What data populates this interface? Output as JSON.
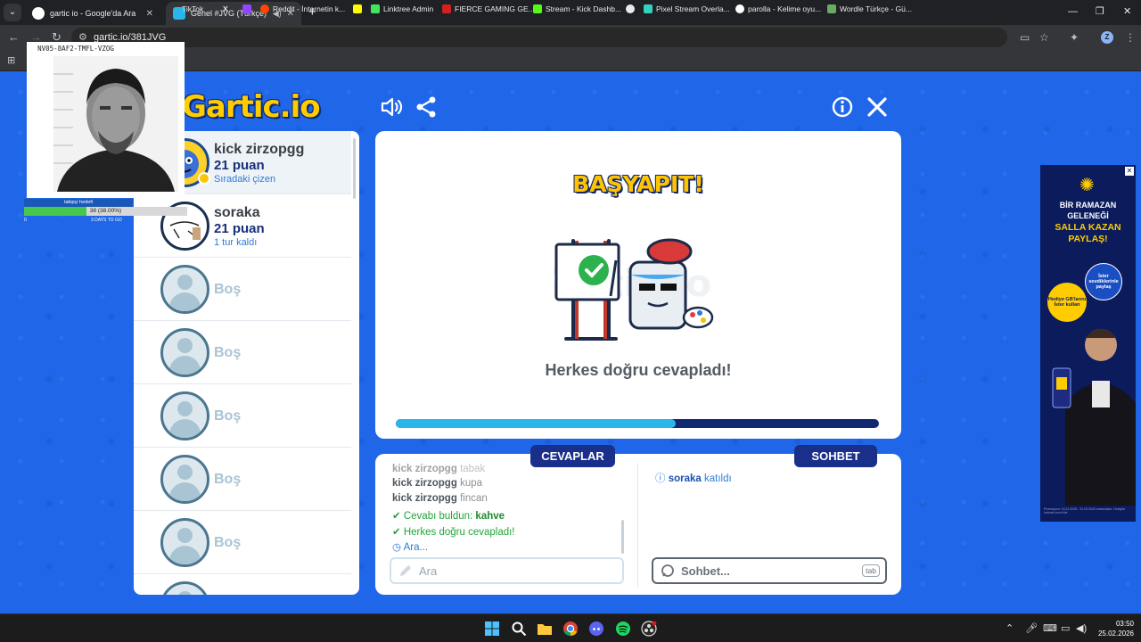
{
  "browser": {
    "tabs": [
      {
        "title": "gartic io - Google'da Ara",
        "active": false
      },
      {
        "title": "Genel #JVG (Türkçe) - Gartic",
        "active": true
      }
    ],
    "url": "gartic.io/381JVG",
    "profile_initial": "Z",
    "bookmarks": [
      "TikTok",
      "",
      "Reddit - İnternetin k...",
      "",
      "Linktree Admin",
      "FIERCE GAMING GE...",
      "Stream - Kick Dashb...",
      "",
      "Pixel Stream Overla...",
      "parolla - Kelime oyu...",
      "Wordle Türkçe - Gü..."
    ]
  },
  "overlay": {
    "id_code": "NV05-8AF2-TMFL-VZOG",
    "goal_label": "takipçi hedefi",
    "goal_value": "38 (38.00%)",
    "goal_fraction": 0.38,
    "goal_min": "0",
    "goal_days": "3 DAYS TO GO"
  },
  "game": {
    "logo": "Gartic.io",
    "players": [
      {
        "name": "kick zirzopgg",
        "score": "21 puan",
        "status": "Sıradaki çizen"
      },
      {
        "name": "soraka",
        "score": "21 puan",
        "status": "1 tur kaldı"
      }
    ],
    "empty_slot": "Boş",
    "result_title": "BAŞYAPIT!",
    "result_message": "Herkes doğru cevapladı!",
    "timer_fraction": 0.58,
    "answers_tab": "CEVAPLAR",
    "chat_tab": "SOHBET",
    "answers": [
      {
        "who": "kick zirzopgg",
        "what": "tabak"
      },
      {
        "who": "kick zirzopgg",
        "what": "kupa"
      },
      {
        "who": "kick zirzopgg",
        "what": "fincan"
      }
    ],
    "found_prefix": "Cevabı buldun:",
    "found_word": "kahve",
    "all_correct": "Herkes doğru cevapladı!",
    "waiting": "Ara...",
    "chat_user": "soraka",
    "chat_action": "katıldı",
    "guess_placeholder": "Ara",
    "chat_placeholder": "Sohbet...",
    "tab_key": "tab"
  },
  "ad": {
    "line1": "BİR RAMAZAN",
    "line2": "GELENEĞİ",
    "line3": "SALLA KAZAN",
    "line4": "PAYLAŞ!",
    "badge1": "İster sevdiklerinle paylaş",
    "badge2": "Hediye GB'larını İster kullan",
    "fine_print": "Promosyon: 16.12.2026 - 31.03.2026 arasındadır. Detaylar turkcell.com.tr'de."
  },
  "taskbar": {
    "time": "03:50",
    "date": "25.02.2026"
  },
  "colors": {
    "game_blue": "#1f67e8",
    "accent_yellow": "#ffc400",
    "navy": "#1a2f8a",
    "timer_cyan": "#29b6ea",
    "correct_green": "#21a53a"
  }
}
